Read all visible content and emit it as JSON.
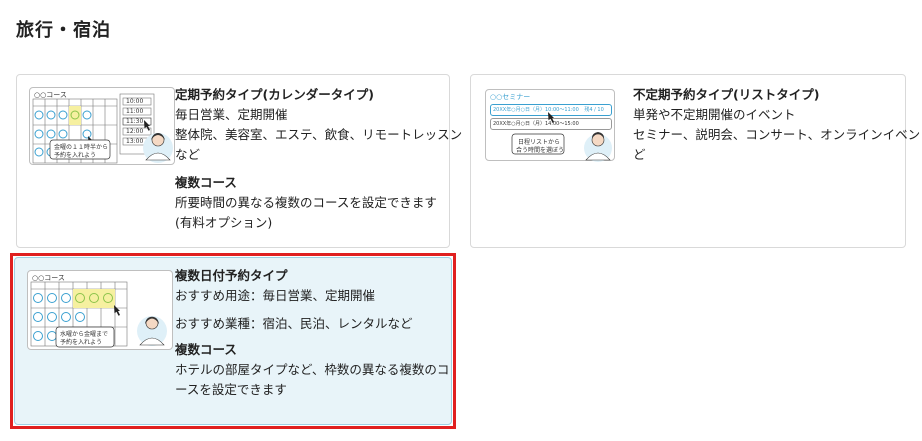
{
  "page": {
    "title": "旅行・宿泊"
  },
  "cards": [
    {
      "title": "定期予約タイプ(カレンダータイプ)",
      "lines": [
        "毎日営業、定期開催",
        "整体院、美容室、エステ、飲食、リモートレッスン",
        "など"
      ],
      "sub_title": "複数コース",
      "sub_lines": [
        "所要時間の異なる複数のコースを設定できます",
        "(有料オプション)"
      ],
      "thumb": {
        "course_label": "○○コース",
        "bubble": [
          "金曜の１１時半から",
          "予約を入れよう"
        ],
        "times": [
          "10:00",
          "11:00",
          "11:30",
          "12:00",
          "13:00"
        ]
      }
    },
    {
      "title": "不定期予約タイプ(リストタイプ)",
      "lines": [
        "単発や不定期開催のイベント",
        "セミナー、説明会、コンサート、オンラインイベントな",
        "ど"
      ],
      "thumb": {
        "seminar_label": "○○セミナー",
        "row1": "20XX年○月○日（月）10:00〜11:00",
        "row1_tag": "残4 / 10",
        "row2": "20XX年○月○日（月）14:00〜15:00",
        "bubble": [
          "日程リストから",
          "合う時間を選ぼう"
        ]
      }
    },
    {
      "title": "複数日付予約タイプ",
      "lines": [
        "おすすめ用途：毎日営業、定期開催",
        "おすすめ業種：宿泊、民泊、レンタルなど"
      ],
      "sub_title": "複数コース",
      "sub_lines": [
        "ホテルの部屋タイプなど、枠数の異なる複数のコ",
        "ースを設定できます"
      ],
      "thumb": {
        "course_label": "○○コース",
        "bubble": [
          "水曜から金曜まで",
          "予約を入れよう"
        ]
      }
    }
  ],
  "colors": {
    "accent_border": "#e02020",
    "selected_bg": "#e8f4f9",
    "circle": "#3aa0d0",
    "highlight_cell": "#f6f0a0"
  }
}
